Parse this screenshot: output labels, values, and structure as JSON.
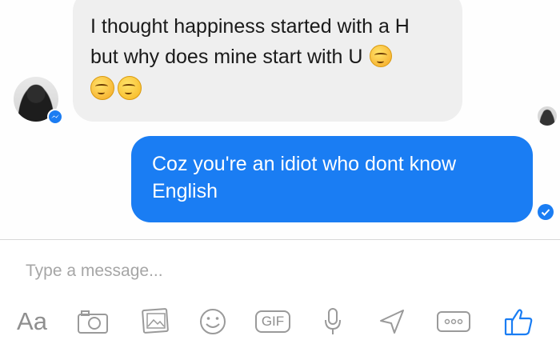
{
  "conversation": {
    "incoming_message": {
      "lines": [
        "I thought happiness started with a H",
        "but why does mine start with U"
      ]
    },
    "outgoing_message": {
      "lines": [
        "Coz you're an idiot who dont know",
        "English"
      ]
    }
  },
  "composer": {
    "placeholder": "Type a message...",
    "value": ""
  },
  "toolbar": {
    "text_format_label": "Aa",
    "gif_label": "GIF",
    "icons": [
      "camera-icon",
      "gallery-icon",
      "emoji-icon",
      "gif-icon",
      "microphone-icon",
      "location-icon",
      "more-icon",
      "like-icon"
    ]
  },
  "colors": {
    "incoming_bubble": "#efefef",
    "outgoing_bubble": "#1a7df3",
    "accent": "#1b7cf2",
    "icon_gray": "#9a9a9a"
  }
}
